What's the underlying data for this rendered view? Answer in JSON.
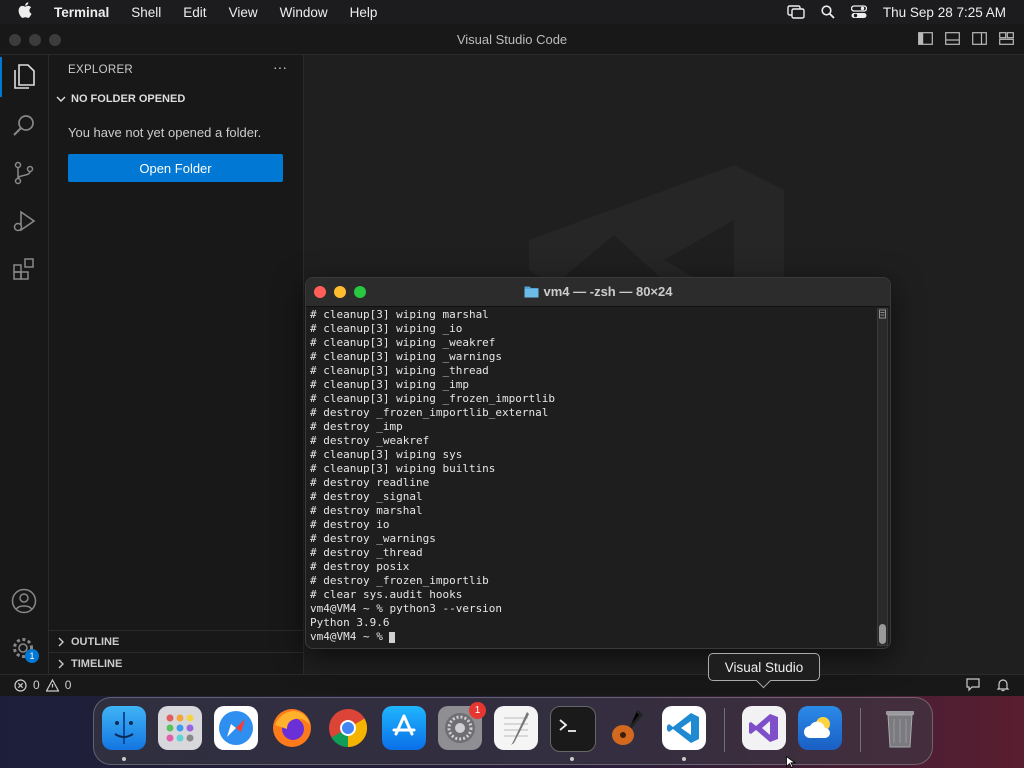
{
  "menubar": {
    "app_name": "Terminal",
    "menus": [
      "Shell",
      "Edit",
      "View",
      "Window",
      "Help"
    ],
    "clock": "Thu Sep 28  7:25 AM"
  },
  "vscode": {
    "window_title": "Visual Studio Code",
    "explorer": {
      "header": "EXPLORER",
      "more": "···",
      "section": "NO FOLDER OPENED",
      "message": "You have not yet opened a folder.",
      "open_button": "Open Folder",
      "outline": "OUTLINE",
      "timeline": "TIMELINE"
    },
    "status": {
      "errors": "0",
      "warnings": "0"
    },
    "accounts_badge": "1"
  },
  "terminal": {
    "title": "vm4 — -zsh — 80×24",
    "lines": [
      "# cleanup[3] wiping marshal",
      "# cleanup[3] wiping _io",
      "# cleanup[3] wiping _weakref",
      "# cleanup[3] wiping _warnings",
      "# cleanup[3] wiping _thread",
      "# cleanup[3] wiping _imp",
      "# cleanup[3] wiping _frozen_importlib",
      "# destroy _frozen_importlib_external",
      "# destroy _imp",
      "# destroy _weakref",
      "# cleanup[3] wiping sys",
      "# cleanup[3] wiping builtins",
      "# destroy readline",
      "# destroy _signal",
      "# destroy marshal",
      "# destroy io",
      "# destroy _warnings",
      "# destroy _thread",
      "# destroy posix",
      "# destroy _frozen_importlib",
      "# clear sys.audit hooks",
      "vm4@VM4 ~ % python3 --version",
      "Python 3.9.6",
      "vm4@VM4 ~ % "
    ]
  },
  "tooltip": "Visual Studio",
  "dock": {
    "settings_badge": "1"
  },
  "colors": {
    "accent": "#0078d4",
    "close": "#ff5f57",
    "minimize": "#febc2e",
    "zoom": "#28c840"
  }
}
